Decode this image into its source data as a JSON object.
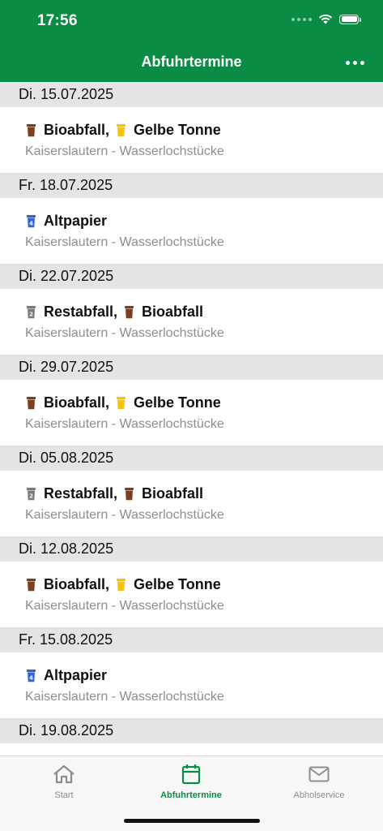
{
  "status_bar": {
    "time": "17:56"
  },
  "header": {
    "title": "Abfuhrtermine",
    "menu_icon": "more-dots-icon"
  },
  "colors": {
    "primary": "#0a8c44",
    "bio": "#7b3f1d",
    "gelbe": "#f6c400",
    "papier": "#3566d8",
    "rest": "#7a7a7a"
  },
  "entries": [
    {
      "date": "Di. 15.07.2025",
      "items": [
        {
          "label": "Bioabfall",
          "bin": "bio"
        },
        {
          "label": "Gelbe Tonne",
          "bin": "gelbe"
        }
      ],
      "location": "Kaiserslautern - Wasserlochstücke"
    },
    {
      "date": "Fr. 18.07.2025",
      "items": [
        {
          "label": "Altpapier",
          "bin": "papier"
        }
      ],
      "location": "Kaiserslautern - Wasserlochstücke"
    },
    {
      "date": "Di. 22.07.2025",
      "items": [
        {
          "label": "Restabfall",
          "bin": "rest"
        },
        {
          "label": "Bioabfall",
          "bin": "bio"
        }
      ],
      "location": "Kaiserslautern - Wasserlochstücke"
    },
    {
      "date": "Di. 29.07.2025",
      "items": [
        {
          "label": "Bioabfall",
          "bin": "bio"
        },
        {
          "label": "Gelbe Tonne",
          "bin": "gelbe"
        }
      ],
      "location": "Kaiserslautern - Wasserlochstücke"
    },
    {
      "date": "Di. 05.08.2025",
      "items": [
        {
          "label": "Restabfall",
          "bin": "rest"
        },
        {
          "label": "Bioabfall",
          "bin": "bio"
        }
      ],
      "location": "Kaiserslautern - Wasserlochstücke"
    },
    {
      "date": "Di. 12.08.2025",
      "items": [
        {
          "label": "Bioabfall",
          "bin": "bio"
        },
        {
          "label": "Gelbe Tonne",
          "bin": "gelbe"
        }
      ],
      "location": "Kaiserslautern - Wasserlochstücke"
    },
    {
      "date": "Fr. 15.08.2025",
      "items": [
        {
          "label": "Altpapier",
          "bin": "papier"
        }
      ],
      "location": "Kaiserslautern - Wasserlochstücke"
    },
    {
      "date": "Di. 19.08.2025",
      "items": [],
      "location": ""
    }
  ],
  "tabbar": {
    "tabs": [
      {
        "label": "Start",
        "icon": "home-icon"
      },
      {
        "label": "Abfuhrtermine",
        "icon": "calendar-icon",
        "active": true
      },
      {
        "label": "Abholservice",
        "icon": "mail-icon"
      }
    ]
  }
}
